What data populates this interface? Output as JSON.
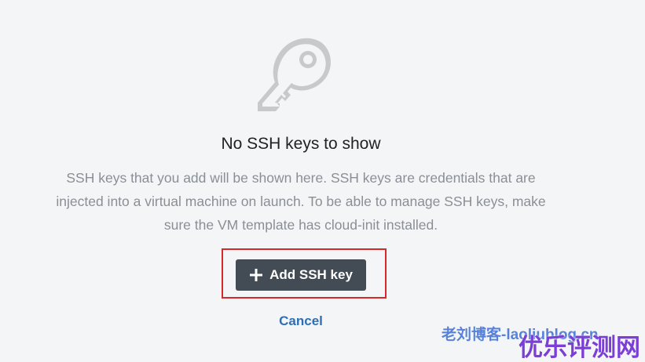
{
  "empty_state": {
    "icon": "key-icon",
    "title": "No SSH keys to show",
    "description_line1": "SSH keys that you add will be shown here. SSH keys are credentials that are",
    "description_line2": "injected into a virtual machine on launch. To be able to manage SSH keys, make",
    "description_line3": "sure the VM template has cloud-init installed."
  },
  "actions": {
    "add_label": "Add SSH key",
    "add_icon": "plus-icon",
    "cancel_label": "Cancel"
  },
  "watermarks": {
    "blue": "老刘博客-laoliublog.cn",
    "purple": "优乐评测网"
  },
  "colors": {
    "background": "#f4f5f7",
    "button": "#434b55",
    "link": "#2f6eb5",
    "highlight_border": "#d62a2a"
  }
}
